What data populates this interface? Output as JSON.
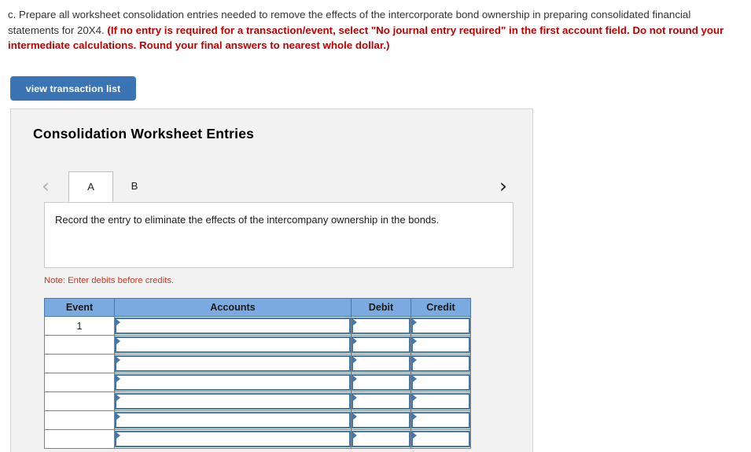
{
  "question": {
    "plain_part_1": "c. Prepare all worksheet consolidation entries needed to remove the effects of the intercorporate bond ownership in preparing consolidated financial statements for 20X4. ",
    "red_bold_part": "(If no entry is required for a transaction/event, select \"No journal entry required\" in the first account field. Do not round your intermediate calculations. Round your final answers to nearest whole dollar.)"
  },
  "toolbar": {
    "view_transaction_list_label": "view transaction list"
  },
  "panel": {
    "title": "Consolidation Worksheet Entries",
    "tabs": {
      "prev_arrow": "‹",
      "next_arrow": "›",
      "items": [
        {
          "label": "A",
          "active": true
        },
        {
          "label": "B",
          "active": false
        }
      ]
    },
    "instruction": "Record the entry to eliminate the effects of the intercompany ownership in the bonds.",
    "note": "Note: Enter debits before credits."
  },
  "journal_table": {
    "headers": {
      "event": "Event",
      "accounts": "Accounts",
      "debit": "Debit",
      "credit": "Credit"
    },
    "rows": [
      {
        "event": "1",
        "accounts": "",
        "debit": "",
        "credit": ""
      },
      {
        "event": "",
        "accounts": "",
        "debit": "",
        "credit": ""
      },
      {
        "event": "",
        "accounts": "",
        "debit": "",
        "credit": ""
      },
      {
        "event": "",
        "accounts": "",
        "debit": "",
        "credit": ""
      },
      {
        "event": "",
        "accounts": "",
        "debit": "",
        "credit": ""
      },
      {
        "event": "",
        "accounts": "",
        "debit": "",
        "credit": ""
      },
      {
        "event": "",
        "accounts": "",
        "debit": "",
        "credit": ""
      }
    ]
  },
  "colors": {
    "button_blue": "#3b74b4",
    "header_blue": "#7baae0",
    "input_border_blue": "#4478ac",
    "red_text": "#c00000",
    "note_red": "#c0392b",
    "panel_bg": "#f2f2f2"
  }
}
